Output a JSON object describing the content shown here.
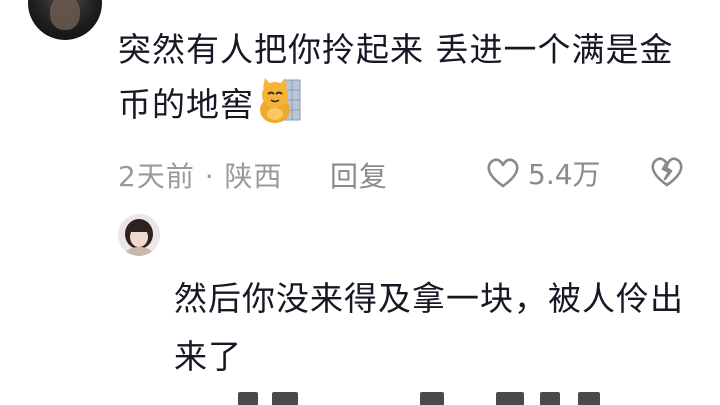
{
  "comment": {
    "text": "突然有人把你拎起来 丢进一个满是金币的地窖",
    "emoji": "cat-sticker-icon",
    "meta": "2天前 · 陕西",
    "reply_label": "回复",
    "like_count": "5.4万"
  },
  "reply": {
    "text": "然后你没来得及拿一块，被人伶出来了"
  },
  "colors": {
    "text": "#161823",
    "meta": "#9a9a9e",
    "background": "#ffffff"
  }
}
